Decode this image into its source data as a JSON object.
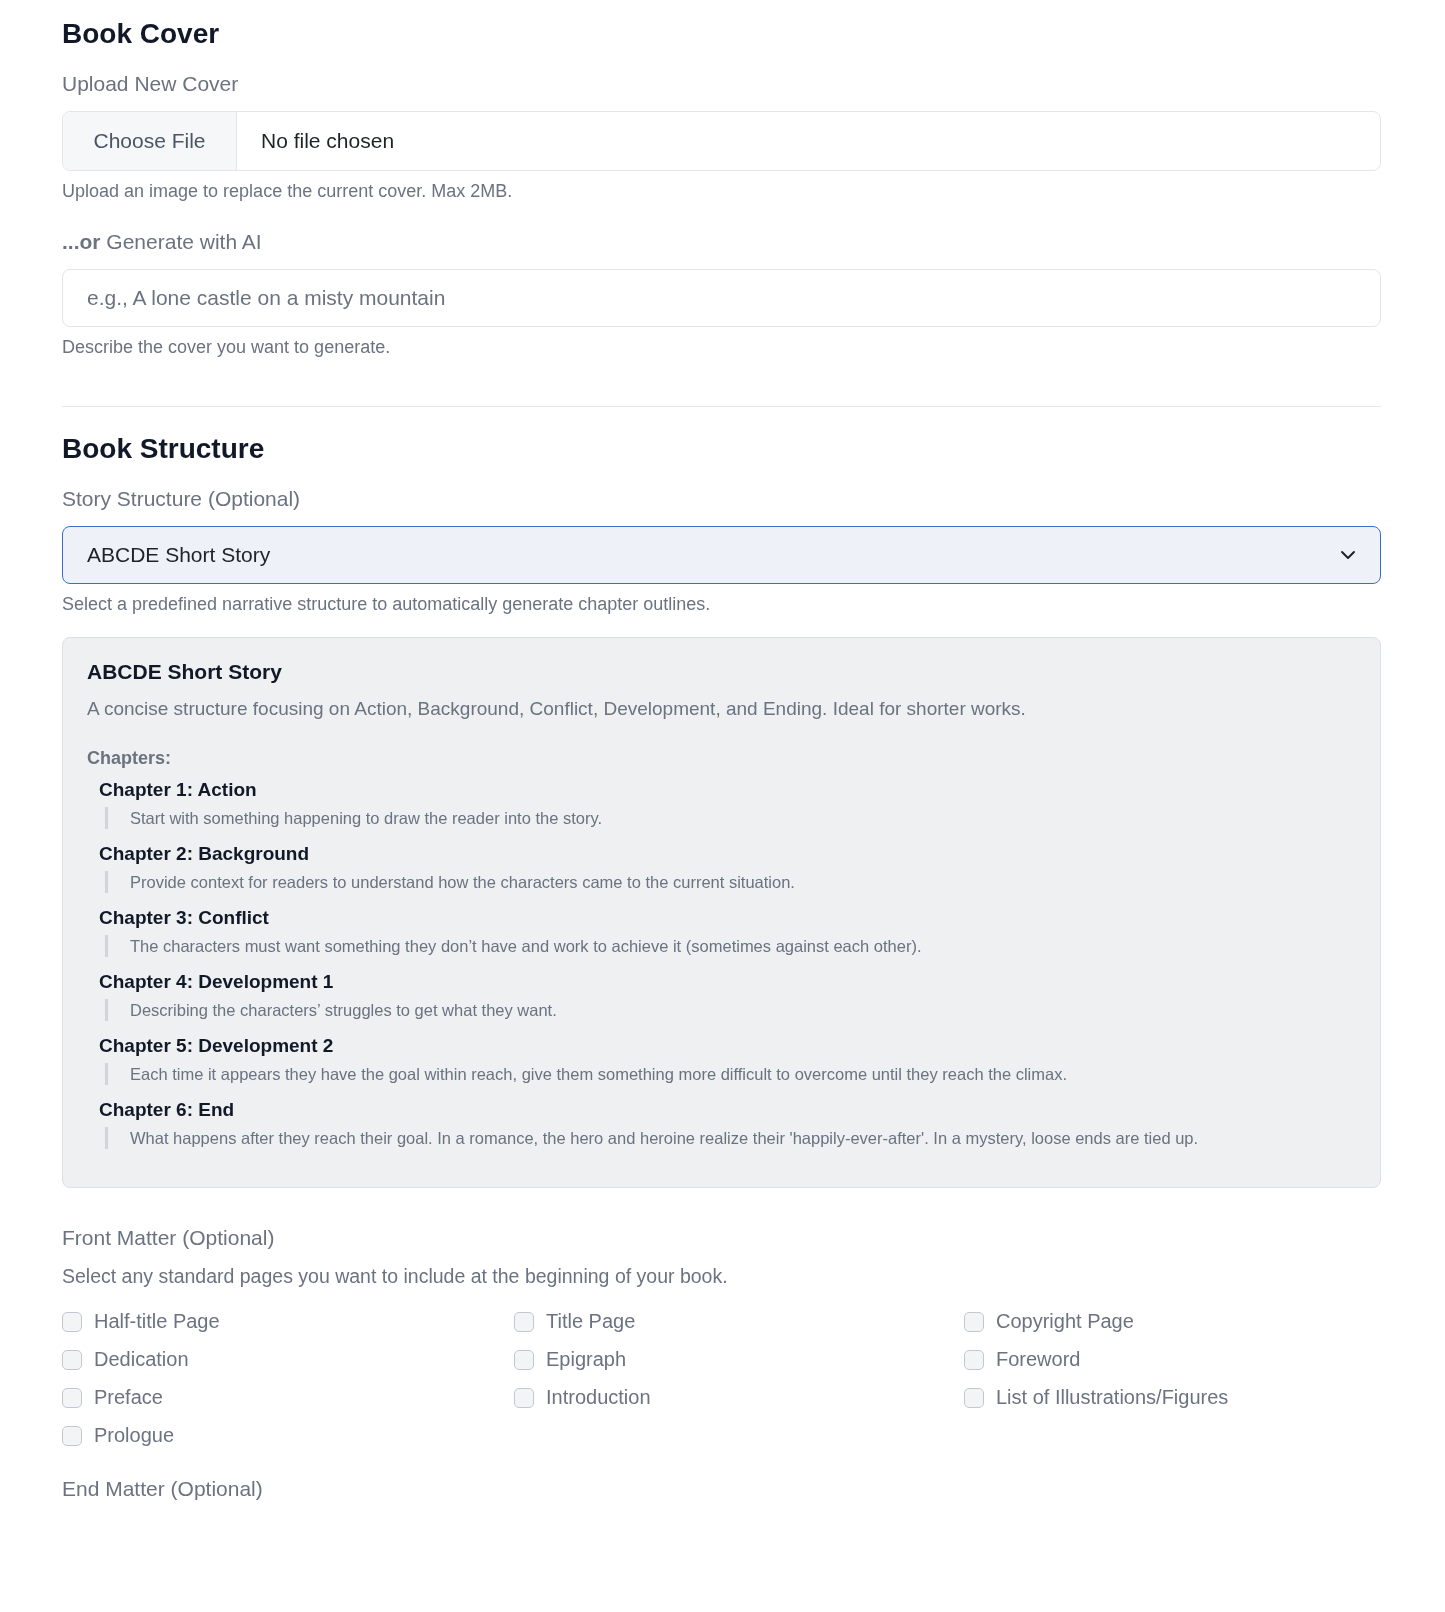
{
  "book_cover": {
    "heading": "Book Cover",
    "upload": {
      "label": "Upload New Cover",
      "button": "Choose File",
      "value": "No file chosen",
      "hint": "Upload an image to replace the current cover. Max 2MB."
    },
    "generate": {
      "label": "**...or** Generate with AI",
      "placeholder": "e.g., A lone castle on a misty mountain",
      "hint": "Describe the cover you want to generate."
    }
  },
  "book_structure": {
    "heading": "Book Structure",
    "story_structure": {
      "label": "Story Structure (Optional)",
      "value": "ABCDE Short Story",
      "hint": "Select a predefined narrative structure to automatically generate chapter outlines."
    },
    "preview": {
      "title": "ABCDE Short Story",
      "description": "A concise structure focusing on Action, Background, Conflict, Development, and Ending. Ideal for shorter works.",
      "chapters_label": "Chapters:",
      "chapters": [
        {
          "title": "Chapter 1: Action",
          "description": "Start with something happening to draw the reader into the story."
        },
        {
          "title": "Chapter 2: Background",
          "description": "Provide context for readers to understand how the characters came to the current situation."
        },
        {
          "title": "Chapter 3: Conflict",
          "description": "The characters must want something they don’t have and work to achieve it (sometimes against each other)."
        },
        {
          "title": "Chapter 4: Development 1",
          "description": "Describing the characters’ struggles to get what they want."
        },
        {
          "title": "Chapter 5: Development 2",
          "description": "Each time it appears they have the goal within reach, give them something more difficult to overcome until they reach the climax."
        },
        {
          "title": "Chapter 6: End",
          "description": "What happens after they reach their goal. In a romance, the hero and heroine realize their 'happily-ever-after'. In a mystery, loose ends are tied up."
        }
      ]
    },
    "front_matter": {
      "label": "Front Matter (Optional)",
      "hint": "Select any standard pages you want to include at the beginning of your book.",
      "options": [
        {
          "label": "Half-title Page",
          "checked": false
        },
        {
          "label": "Title Page",
          "checked": false
        },
        {
          "label": "Copyright Page",
          "checked": false
        },
        {
          "label": "Dedication",
          "checked": false
        },
        {
          "label": "Epigraph",
          "checked": false
        },
        {
          "label": "Foreword",
          "checked": false
        },
        {
          "label": "Preface",
          "checked": false
        },
        {
          "label": "Introduction",
          "checked": false
        },
        {
          "label": "List of Illustrations/Figures",
          "checked": false
        },
        {
          "label": "Prologue",
          "checked": false
        }
      ]
    },
    "end_matter": {
      "label": "End Matter (Optional)"
    }
  }
}
